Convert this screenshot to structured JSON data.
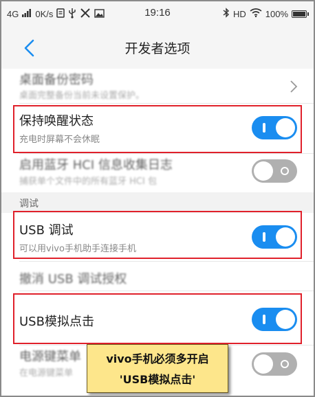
{
  "status_bar": {
    "network": "4G",
    "speed": "0K/s",
    "time": "19:16",
    "hd": "HD",
    "battery": "100%",
    "battery_level": 1.0
  },
  "header": {
    "title": "开发者选项"
  },
  "rows": {
    "desktop_backup": {
      "title": "桌面备份密码",
      "subtitle": "桌面完整备份当前未设置保护。"
    },
    "stay_awake": {
      "title": "保持唤醒状态",
      "subtitle": "充电时屏幕不会休眠",
      "enabled": true
    },
    "bt_hci_log": {
      "title": "启用蓝牙 HCI 信息收集日志",
      "subtitle": "捕获单个文件中的所有蓝牙 HCI 包",
      "enabled": false
    },
    "usb_debugging": {
      "title": "USB 调试",
      "subtitle": "可以用vivo手机助手连接手机",
      "enabled": true
    },
    "revoke_usb_auth": {
      "title": "撤消 USB 调试授权"
    },
    "usb_simulated_click": {
      "title": "USB模拟点击",
      "enabled": true
    },
    "power_menu": {
      "title": "电源键菜单",
      "subtitle": "在电源键菜单",
      "enabled": false
    }
  },
  "sections": {
    "debug": "调试"
  },
  "callout": {
    "line1": "vivo手机必须多开启",
    "line2": "'USB模拟点击'"
  },
  "colors": {
    "toggle_on": "#1a8df0",
    "toggle_off": "#b0b0b0",
    "highlight": "#e0202a",
    "callout_bg": "#fde68b"
  }
}
